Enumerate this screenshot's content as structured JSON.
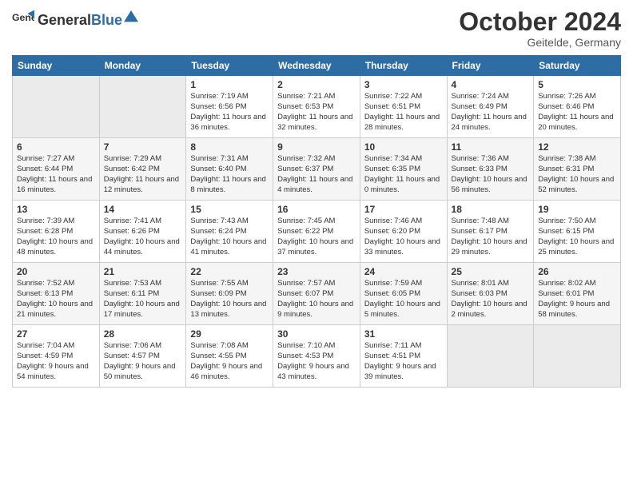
{
  "header": {
    "logo_general": "General",
    "logo_blue": "Blue",
    "month_title": "October 2024",
    "subtitle": "Geitelde, Germany"
  },
  "days_of_week": [
    "Sunday",
    "Monday",
    "Tuesday",
    "Wednesday",
    "Thursday",
    "Friday",
    "Saturday"
  ],
  "weeks": [
    [
      {
        "day": "",
        "text": "",
        "empty": true
      },
      {
        "day": "",
        "text": "",
        "empty": true
      },
      {
        "day": "1",
        "text": "Sunrise: 7:19 AM\nSunset: 6:56 PM\nDaylight: 11 hours and 36 minutes."
      },
      {
        "day": "2",
        "text": "Sunrise: 7:21 AM\nSunset: 6:53 PM\nDaylight: 11 hours and 32 minutes."
      },
      {
        "day": "3",
        "text": "Sunrise: 7:22 AM\nSunset: 6:51 PM\nDaylight: 11 hours and 28 minutes."
      },
      {
        "day": "4",
        "text": "Sunrise: 7:24 AM\nSunset: 6:49 PM\nDaylight: 11 hours and 24 minutes."
      },
      {
        "day": "5",
        "text": "Sunrise: 7:26 AM\nSunset: 6:46 PM\nDaylight: 11 hours and 20 minutes."
      }
    ],
    [
      {
        "day": "6",
        "text": "Sunrise: 7:27 AM\nSunset: 6:44 PM\nDaylight: 11 hours and 16 minutes."
      },
      {
        "day": "7",
        "text": "Sunrise: 7:29 AM\nSunset: 6:42 PM\nDaylight: 11 hours and 12 minutes."
      },
      {
        "day": "8",
        "text": "Sunrise: 7:31 AM\nSunset: 6:40 PM\nDaylight: 11 hours and 8 minutes."
      },
      {
        "day": "9",
        "text": "Sunrise: 7:32 AM\nSunset: 6:37 PM\nDaylight: 11 hours and 4 minutes."
      },
      {
        "day": "10",
        "text": "Sunrise: 7:34 AM\nSunset: 6:35 PM\nDaylight: 11 hours and 0 minutes."
      },
      {
        "day": "11",
        "text": "Sunrise: 7:36 AM\nSunset: 6:33 PM\nDaylight: 10 hours and 56 minutes."
      },
      {
        "day": "12",
        "text": "Sunrise: 7:38 AM\nSunset: 6:31 PM\nDaylight: 10 hours and 52 minutes."
      }
    ],
    [
      {
        "day": "13",
        "text": "Sunrise: 7:39 AM\nSunset: 6:28 PM\nDaylight: 10 hours and 48 minutes."
      },
      {
        "day": "14",
        "text": "Sunrise: 7:41 AM\nSunset: 6:26 PM\nDaylight: 10 hours and 44 minutes."
      },
      {
        "day": "15",
        "text": "Sunrise: 7:43 AM\nSunset: 6:24 PM\nDaylight: 10 hours and 41 minutes."
      },
      {
        "day": "16",
        "text": "Sunrise: 7:45 AM\nSunset: 6:22 PM\nDaylight: 10 hours and 37 minutes."
      },
      {
        "day": "17",
        "text": "Sunrise: 7:46 AM\nSunset: 6:20 PM\nDaylight: 10 hours and 33 minutes."
      },
      {
        "day": "18",
        "text": "Sunrise: 7:48 AM\nSunset: 6:17 PM\nDaylight: 10 hours and 29 minutes."
      },
      {
        "day": "19",
        "text": "Sunrise: 7:50 AM\nSunset: 6:15 PM\nDaylight: 10 hours and 25 minutes."
      }
    ],
    [
      {
        "day": "20",
        "text": "Sunrise: 7:52 AM\nSunset: 6:13 PM\nDaylight: 10 hours and 21 minutes."
      },
      {
        "day": "21",
        "text": "Sunrise: 7:53 AM\nSunset: 6:11 PM\nDaylight: 10 hours and 17 minutes."
      },
      {
        "day": "22",
        "text": "Sunrise: 7:55 AM\nSunset: 6:09 PM\nDaylight: 10 hours and 13 minutes."
      },
      {
        "day": "23",
        "text": "Sunrise: 7:57 AM\nSunset: 6:07 PM\nDaylight: 10 hours and 9 minutes."
      },
      {
        "day": "24",
        "text": "Sunrise: 7:59 AM\nSunset: 6:05 PM\nDaylight: 10 hours and 5 minutes."
      },
      {
        "day": "25",
        "text": "Sunrise: 8:01 AM\nSunset: 6:03 PM\nDaylight: 10 hours and 2 minutes."
      },
      {
        "day": "26",
        "text": "Sunrise: 8:02 AM\nSunset: 6:01 PM\nDaylight: 9 hours and 58 minutes."
      }
    ],
    [
      {
        "day": "27",
        "text": "Sunrise: 7:04 AM\nSunset: 4:59 PM\nDaylight: 9 hours and 54 minutes."
      },
      {
        "day": "28",
        "text": "Sunrise: 7:06 AM\nSunset: 4:57 PM\nDaylight: 9 hours and 50 minutes."
      },
      {
        "day": "29",
        "text": "Sunrise: 7:08 AM\nSunset: 4:55 PM\nDaylight: 9 hours and 46 minutes."
      },
      {
        "day": "30",
        "text": "Sunrise: 7:10 AM\nSunset: 4:53 PM\nDaylight: 9 hours and 43 minutes."
      },
      {
        "day": "31",
        "text": "Sunrise: 7:11 AM\nSunset: 4:51 PM\nDaylight: 9 hours and 39 minutes."
      },
      {
        "day": "",
        "text": "",
        "empty": true
      },
      {
        "day": "",
        "text": "",
        "empty": true
      }
    ]
  ]
}
